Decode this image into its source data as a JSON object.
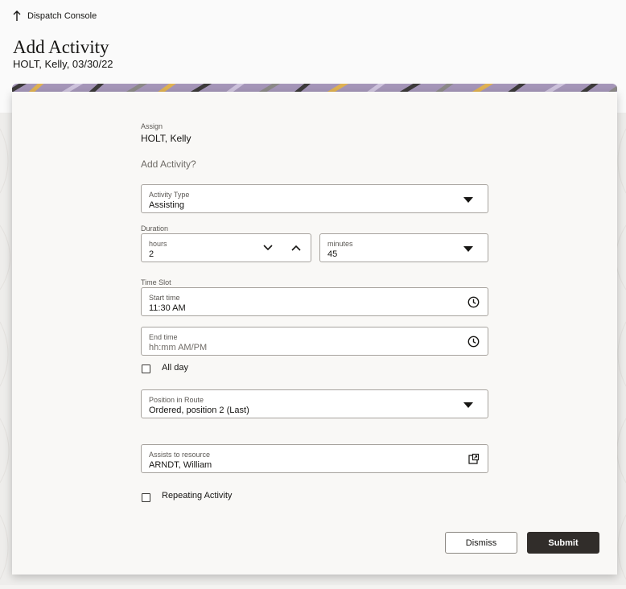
{
  "header": {
    "back_label": "Dispatch Console",
    "title": "Add Activity",
    "subtitle": "HOLT, Kelly, 03/30/22"
  },
  "form": {
    "assign_label": "Assign",
    "assign_value": "HOLT, Kelly",
    "prompt": "Add Activity?",
    "activity_type": {
      "label": "Activity Type",
      "value": "Assisting"
    },
    "duration": {
      "label": "Duration",
      "hours": {
        "label": "hours",
        "value": "2"
      },
      "minutes": {
        "label": "minutes",
        "value": "45"
      }
    },
    "time_slot": {
      "label": "Time Slot",
      "start": {
        "label": "Start time",
        "value": "11:30 AM"
      },
      "end": {
        "label": "End time",
        "placeholder": "hh:mm AM/PM"
      }
    },
    "all_day": {
      "label": "All day",
      "checked": false
    },
    "position": {
      "label": "Position in Route",
      "value": "Ordered, position 2 (Last)"
    },
    "assists_to": {
      "label": "Assists to resource",
      "value": "ARNDT, William"
    },
    "repeating": {
      "label": "Repeating Activity",
      "checked": false
    }
  },
  "buttons": {
    "dismiss": "Dismiss",
    "submit": "Submit"
  },
  "icons": {
    "back": "arrow-up-icon",
    "dropdown": "caret-down-icon",
    "hours_down": "chevron-down-icon",
    "hours_up": "chevron-up-icon",
    "clock": "clock-icon",
    "external": "open-external-icon"
  },
  "colors": {
    "primary_button": "#312d2a",
    "card_background": "#f9f8f6",
    "banner_purple": "#9b86b8",
    "banner_gold": "#e0b252"
  }
}
